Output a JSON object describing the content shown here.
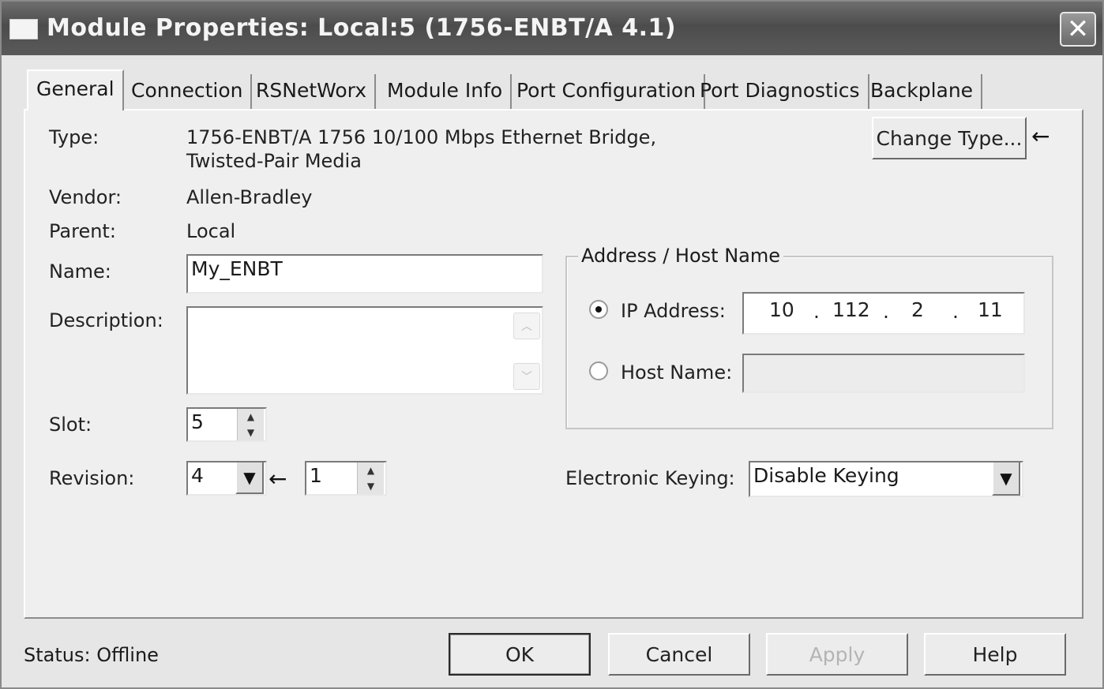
{
  "window": {
    "title": "Module Properties: Local:5 (1756-ENBT/A 4.1)",
    "close_glyph": "✕"
  },
  "tabs": [
    {
      "label": "General",
      "active": true
    },
    {
      "label": "Connection"
    },
    {
      "label": "RSNetWorx"
    },
    {
      "label": "Module Info"
    },
    {
      "label": "Port Configuration"
    },
    {
      "label": "Port Diagnostics"
    },
    {
      "label": "Backplane"
    }
  ],
  "general": {
    "type_label": "Type:",
    "type_line1": "1756-ENBT/A 1756 10/100 Mbps Ethernet Bridge,",
    "type_line2": "Twisted-Pair Media",
    "change_type_button": "Change Type...",
    "vendor_label": "Vendor:",
    "vendor_value": "Allen-Bradley",
    "parent_label": "Parent:",
    "parent_value": "Local",
    "name_label": "Name:",
    "name_value": "My_ENBT",
    "description_label": "Description:",
    "description_value": "",
    "slot_label": "Slot:",
    "slot_value": "5",
    "revision_label": "Revision:",
    "revision_major": "4",
    "revision_minor": "1"
  },
  "address": {
    "group_title": "Address / Host Name",
    "ip_label": "IP Address:",
    "ip_octets": [
      "10",
      "112",
      "2",
      "11"
    ],
    "ip_dot": ".",
    "host_label": "Host Name:",
    "host_value": "",
    "selected": "ip"
  },
  "keying": {
    "label": "Electronic Keying:",
    "value": "Disable Keying"
  },
  "footer": {
    "status_text": "Status:  Offline",
    "ok": "OK",
    "cancel": "Cancel",
    "apply": "Apply",
    "help": "Help"
  },
  "glyphs": {
    "annotation_arrow": "←",
    "dropdown_arrow": "▼",
    "spin_up": "▲",
    "spin_down": "▼",
    "scroll_up": "︿",
    "scroll_down": "﹀"
  },
  "colors": {
    "titlebar": "#5a5a5a",
    "dialog": "#efefef",
    "disabled_text": "#b4b4b4"
  }
}
